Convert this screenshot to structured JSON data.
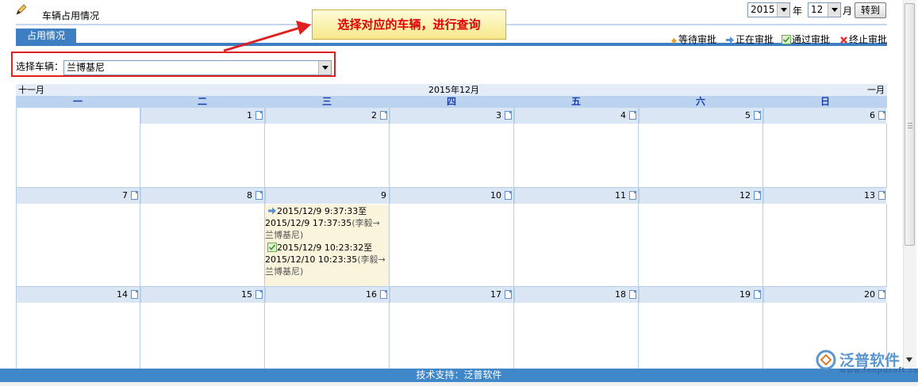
{
  "header": {
    "page_title": "车辆占用情况",
    "year_value": "2015",
    "year_unit": "年",
    "month_value": "12",
    "month_unit": "月",
    "goto_label": "转到"
  },
  "tab": {
    "label": "占用情况"
  },
  "legend": [
    {
      "label": "等待审批",
      "icon": "diamond-icon",
      "color": "#f0a020"
    },
    {
      "label": "正在审批",
      "icon": "arrow-right-icon",
      "color": "#5a8fd0"
    },
    {
      "label": "通过审批",
      "icon": "check-icon",
      "color": "#6ab04a"
    },
    {
      "label": "终止审批",
      "icon": "x-icon",
      "color": "#e03030"
    }
  ],
  "vehicle": {
    "label": "选择车辆：",
    "selected": "兰博基尼"
  },
  "callout": {
    "text": "选择对应的车辆，进行查询"
  },
  "calendar": {
    "prev_month": "十一月",
    "current": "2015年12月",
    "next_month": "一月",
    "weekdays": [
      "一",
      "二",
      "三",
      "四",
      "五",
      "六",
      "日"
    ],
    "weeks": [
      [
        "",
        "1",
        "2",
        "3",
        "4",
        "5",
        "6"
      ],
      [
        "7",
        "8",
        "9",
        "10",
        "11",
        "12",
        "13"
      ],
      [
        "14",
        "15",
        "16",
        "17",
        "18",
        "19",
        "20"
      ]
    ],
    "events_day9": [
      {
        "icon": "arrow-right-icon",
        "line1": "2015/12/9 9:37:33至",
        "line2": "2015/12/9 17:37:35",
        "paren": "(李毅→",
        "line3": "兰博基尼)"
      },
      {
        "icon": "check-icon",
        "line1": "2015/12/9 10:23:32至",
        "line2": "2015/12/10 10:23:35",
        "paren": "(李毅→",
        "line3": "兰博基尼)"
      }
    ]
  },
  "footer": {
    "text": "技术支持：泛普软件"
  },
  "watermark": {
    "brand": "泛普软件",
    "url": "www.fanpusoft.com"
  },
  "colors": {
    "accent": "#3d7fc2",
    "callout_text": "#e00000",
    "highlight_border": "#e02020"
  }
}
